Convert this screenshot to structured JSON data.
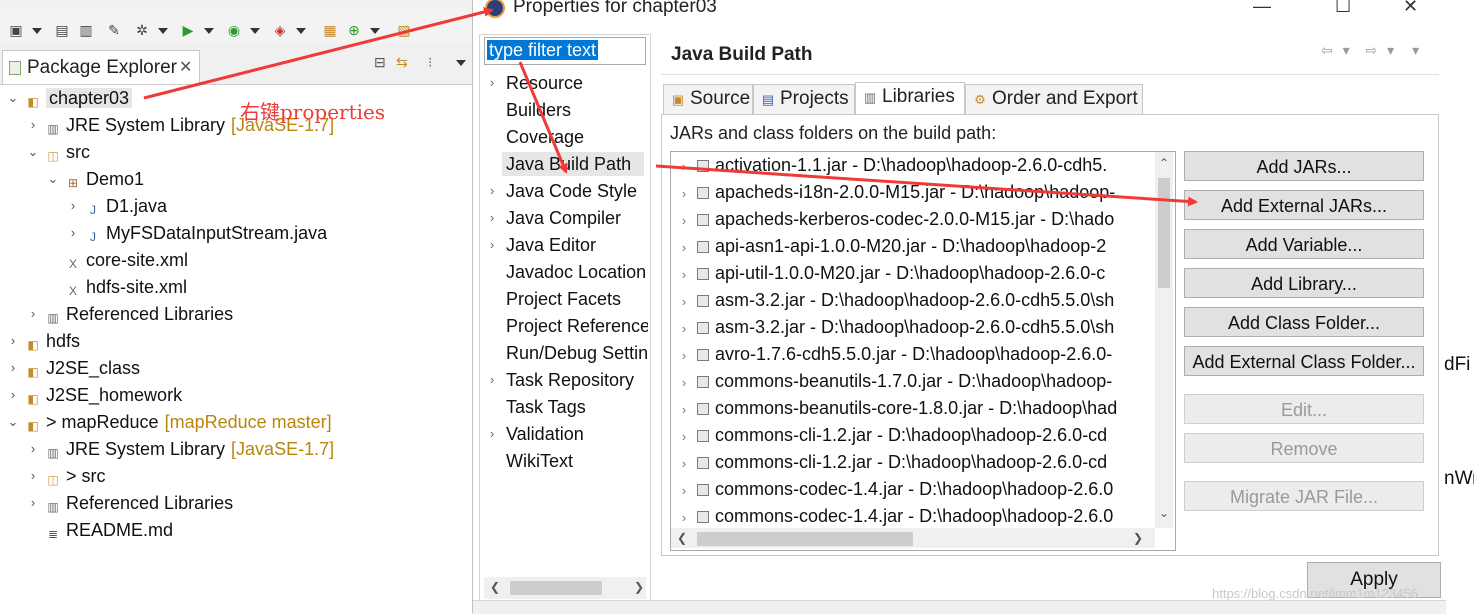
{
  "package_explorer": {
    "tab_label": "Package Explorer",
    "tree": [
      {
        "label": "chapter03",
        "annotation": "",
        "icon": "project-icon",
        "expanded": true,
        "depth": 0
      },
      {
        "label": "JRE System Library",
        "annotation": "[JavaSE-1.7]",
        "icon": "library-icon",
        "expanded": false,
        "depth": 1
      },
      {
        "label": "src",
        "annotation": "",
        "icon": "source-folder-icon",
        "expanded": true,
        "depth": 1
      },
      {
        "label": "Demo1",
        "annotation": "",
        "icon": "package-icon",
        "expanded": true,
        "depth": 2
      },
      {
        "label": "D1.java",
        "annotation": "",
        "icon": "java-file-icon",
        "expanded": false,
        "depth": 3
      },
      {
        "label": "MyFSDataInputStream.java",
        "annotation": "",
        "icon": "java-file-icon",
        "expanded": false,
        "depth": 3
      },
      {
        "label": "core-site.xml",
        "annotation": "",
        "icon": "xml-file-icon",
        "expanded": null,
        "depth": 2
      },
      {
        "label": "hdfs-site.xml",
        "annotation": "",
        "icon": "xml-file-icon",
        "expanded": null,
        "depth": 2
      },
      {
        "label": "Referenced Libraries",
        "annotation": "",
        "icon": "library-icon",
        "expanded": false,
        "depth": 1
      },
      {
        "label": "hdfs",
        "annotation": "",
        "icon": "project-icon",
        "expanded": false,
        "depth": 0
      },
      {
        "label": "J2SE_class",
        "annotation": "",
        "icon": "project-icon",
        "expanded": false,
        "depth": 0
      },
      {
        "label": "J2SE_homework",
        "annotation": "",
        "icon": "project-icon",
        "expanded": false,
        "depth": 0
      },
      {
        "label": "> mapReduce",
        "annotation": "[mapReduce master]",
        "icon": "project-icon",
        "expanded": true,
        "depth": 0
      },
      {
        "label": "JRE System Library",
        "annotation": "[JavaSE-1.7]",
        "icon": "library-icon",
        "expanded": false,
        "depth": 1
      },
      {
        "label": "> src",
        "annotation": "",
        "icon": "source-folder-icon",
        "expanded": false,
        "depth": 1
      },
      {
        "label": "Referenced Libraries",
        "annotation": "",
        "icon": "library-icon",
        "expanded": false,
        "depth": 1
      },
      {
        "label": "README.md",
        "annotation": "",
        "icon": "md-file-icon",
        "expanded": null,
        "depth": 1
      }
    ]
  },
  "hint_text": "右键properties",
  "dialog": {
    "title": "Properties for chapter03",
    "filter_placeholder": "type filter text",
    "nav_items": [
      {
        "label": "Resource",
        "expandable": true
      },
      {
        "label": "Builders",
        "expandable": false
      },
      {
        "label": "Coverage",
        "expandable": false
      },
      {
        "label": "Java Build Path",
        "expandable": false,
        "selected": true
      },
      {
        "label": "Java Code Style",
        "expandable": true
      },
      {
        "label": "Java Compiler",
        "expandable": true
      },
      {
        "label": "Java Editor",
        "expandable": true
      },
      {
        "label": "Javadoc Location",
        "expandable": false
      },
      {
        "label": "Project Facets",
        "expandable": false
      },
      {
        "label": "Project References",
        "expandable": false
      },
      {
        "label": "Run/Debug Settings",
        "expandable": false
      },
      {
        "label": "Task Repository",
        "expandable": true
      },
      {
        "label": "Task Tags",
        "expandable": false
      },
      {
        "label": "Validation",
        "expandable": true
      },
      {
        "label": "WikiText",
        "expandable": false
      }
    ],
    "page_title": "Java Build Path",
    "tabs": [
      {
        "label": "Source",
        "active": false
      },
      {
        "label": "Projects",
        "active": false
      },
      {
        "label": "Libraries",
        "active": true
      },
      {
        "label": "Order and Export",
        "active": false
      }
    ],
    "jars_label": "JARs and class folders on the build path:",
    "jars": [
      "activation-1.1.jar - D:\\hadoop\\hadoop-2.6.0-cdh5.",
      "apacheds-i18n-2.0.0-M15.jar - D:\\hadoop\\hadoop-",
      "apacheds-kerberos-codec-2.0.0-M15.jar - D:\\hado",
      "api-asn1-api-1.0.0-M20.jar - D:\\hadoop\\hadoop-2",
      "api-util-1.0.0-M20.jar - D:\\hadoop\\hadoop-2.6.0-c",
      "asm-3.2.jar - D:\\hadoop\\hadoop-2.6.0-cdh5.5.0\\sh",
      "asm-3.2.jar - D:\\hadoop\\hadoop-2.6.0-cdh5.5.0\\sh",
      "avro-1.7.6-cdh5.5.0.jar - D:\\hadoop\\hadoop-2.6.0-",
      "commons-beanutils-1.7.0.jar - D:\\hadoop\\hadoop-",
      "commons-beanutils-core-1.8.0.jar - D:\\hadoop\\had",
      "commons-cli-1.2.jar - D:\\hadoop\\hadoop-2.6.0-cd",
      "commons-cli-1.2.jar - D:\\hadoop\\hadoop-2.6.0-cd",
      "commons-codec-1.4.jar - D:\\hadoop\\hadoop-2.6.0",
      "commons-codec-1.4.jar - D:\\hadoop\\hadoop-2.6.0"
    ],
    "buttons": [
      {
        "label": "Add JARs...",
        "enabled": true,
        "name": "add-jars-button"
      },
      {
        "label": "Add External JARs...",
        "enabled": true,
        "name": "add-external-jars-button"
      },
      {
        "label": "Add Variable...",
        "enabled": true,
        "name": "add-variable-button"
      },
      {
        "label": "Add Library...",
        "enabled": true,
        "name": "add-library-button"
      },
      {
        "label": "Add Class Folder...",
        "enabled": true,
        "name": "add-class-folder-button"
      },
      {
        "label": "Add External Class Folder...",
        "enabled": true,
        "name": "add-external-class-folder-button"
      },
      {
        "label": "Edit...",
        "enabled": false,
        "name": "edit-button"
      },
      {
        "label": "Remove",
        "enabled": false,
        "name": "remove-button"
      },
      {
        "label": "Migrate JAR File...",
        "enabled": false,
        "name": "migrate-jar-file-button"
      }
    ],
    "apply_label": "Apply"
  },
  "editor_fragments": [
    "dFi",
    "nWr"
  ],
  "watermark": "https://blog.csdn.net/lmm1m123456",
  "colors": {
    "annotation_arrow": "#ef3a3a",
    "selection": "#0078d7"
  }
}
